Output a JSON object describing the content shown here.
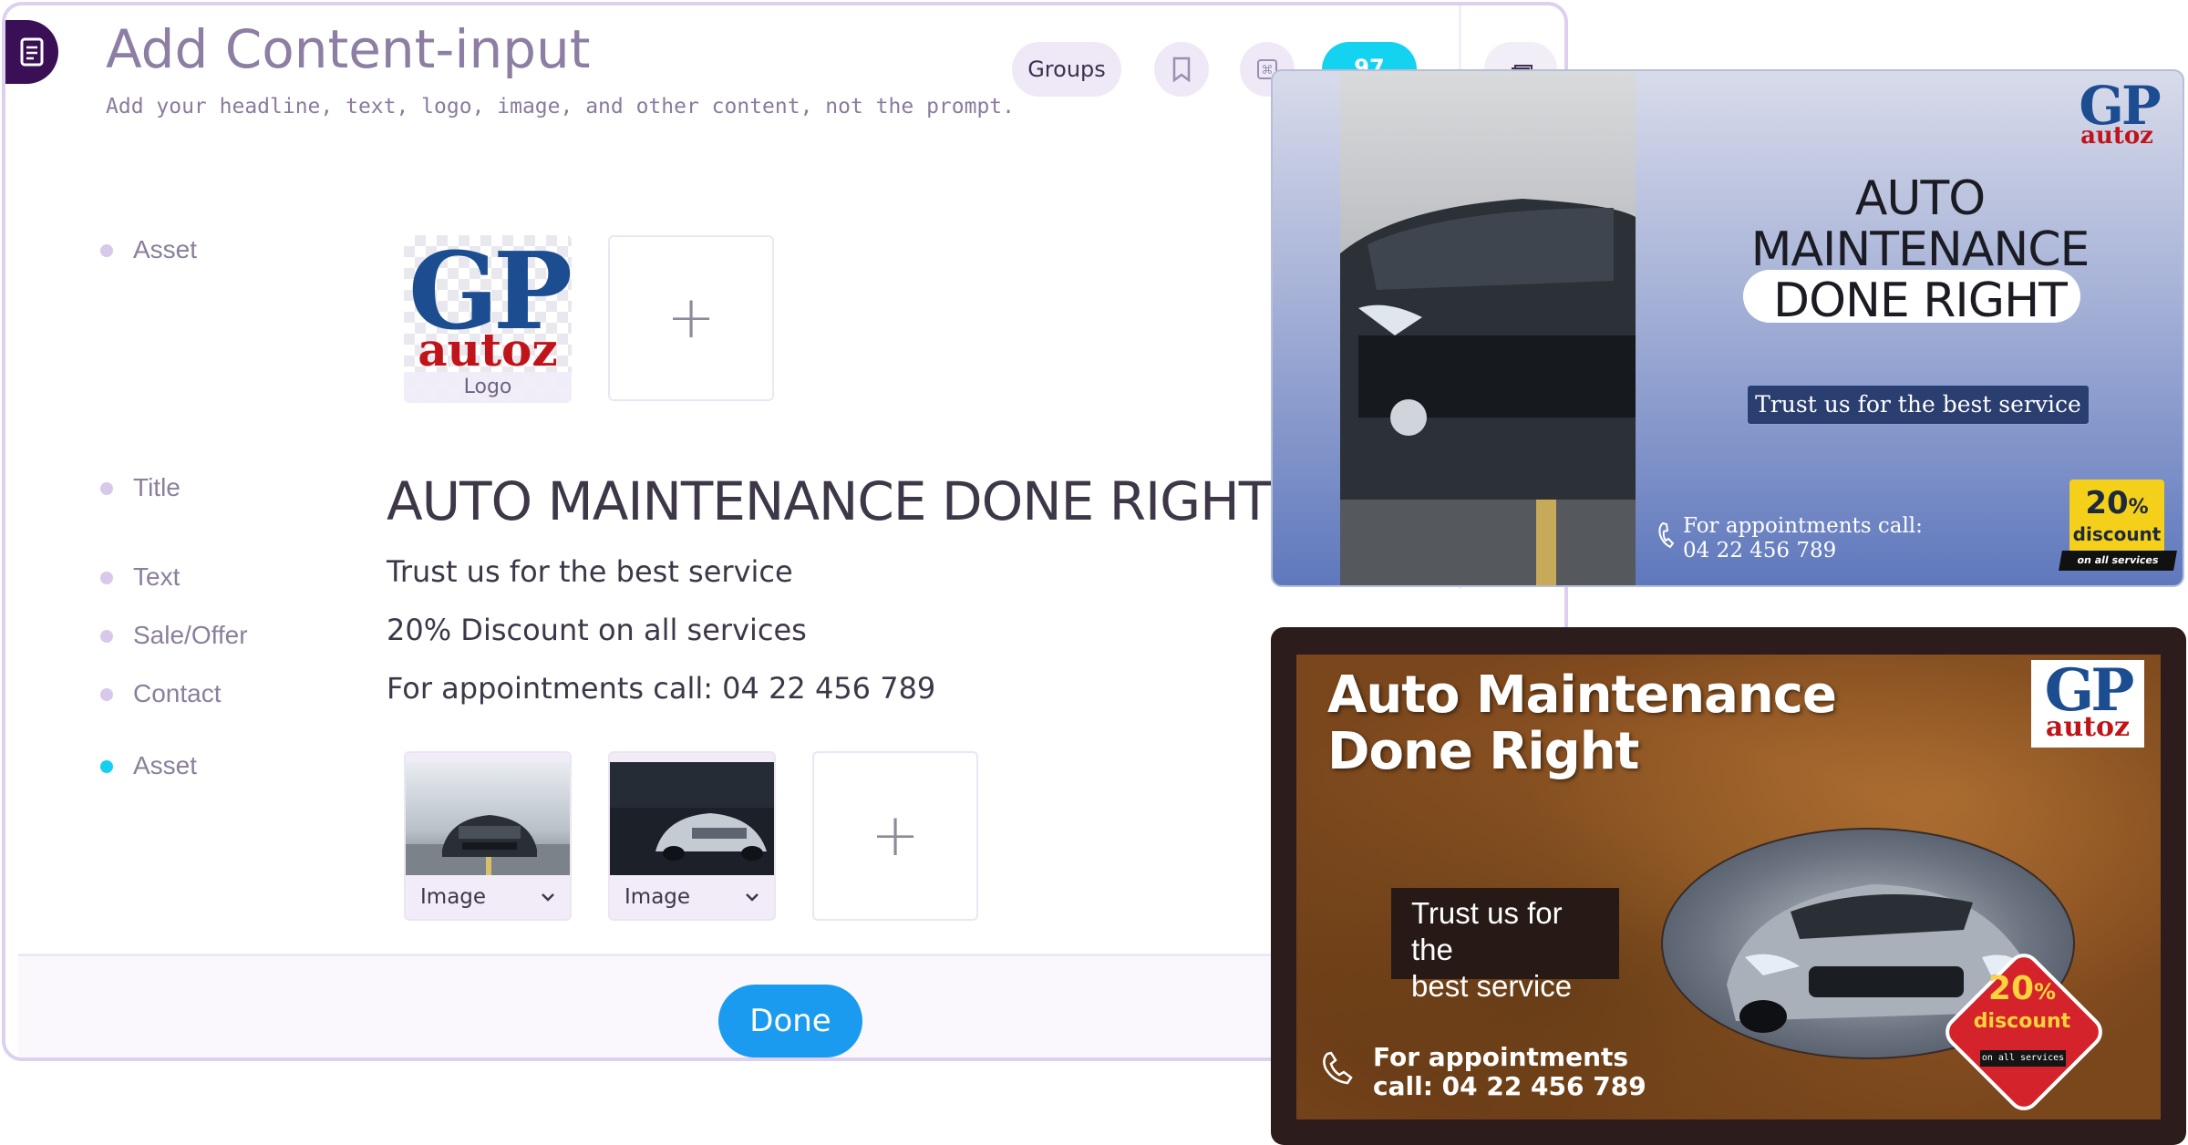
{
  "editor": {
    "title": "Add Content-input",
    "subtitle": "Add your headline, text, logo, image, and other content, not the prompt.",
    "toolbar": {
      "groups_label": "Groups",
      "counter": "97"
    },
    "fields": [
      {
        "label": "Asset"
      },
      {
        "label": "Title",
        "value": "AUTO MAINTENANCE DONE RIGHT"
      },
      {
        "label": "Text",
        "value": "Trust us for the best service"
      },
      {
        "label": "Sale/Offer",
        "value": "20% Discount on all services"
      },
      {
        "label": "Contact",
        "value": "For appointments call: 04 22 456 789"
      },
      {
        "label": "Asset"
      }
    ],
    "logo_asset": {
      "mark_gp": "GP",
      "mark_autoz": "autoz",
      "caption": "Logo"
    },
    "add_glyph": "+",
    "image_assets": [
      {
        "type_label": "Image"
      },
      {
        "type_label": "Image"
      }
    ],
    "done_label": "Done"
  },
  "ad_preview_1": {
    "logo_gp": "GP",
    "logo_autoz": "autoz",
    "title_line1": "AUTO",
    "title_line2": "MAINTENANCE",
    "title_line3": "DONE RIGHT",
    "text": "Trust us for the best service",
    "contact_line1": "For appointments call:",
    "contact_line2": "04 22 456 789",
    "discount_pct": "20",
    "discount_pct_sign": "%",
    "discount_word": "discount",
    "discount_note": "on all services"
  },
  "ad_preview_2": {
    "title_line1": "Auto Maintenance",
    "title_line2": "Done Right",
    "logo_gp": "GP",
    "logo_autoz": "autoz",
    "text_line1": "Trust us for the",
    "text_line2": "best service",
    "discount_pct": "20",
    "discount_pct_sign": "%",
    "discount_word": "discount",
    "discount_note": "on all services",
    "contact_line1": "For appointments",
    "contact_line2": "call: 04 22 456 789"
  },
  "colors": {
    "accent_purple": "#3a0f55",
    "counter_cyan": "#13d3f0",
    "done_blue": "#1a9bf0",
    "logo_blue": "#1c4d91",
    "logo_red": "#c0141a",
    "discount_yellow": "#f4d01b",
    "discount_red": "#d4232a"
  },
  "icons": [
    "document-icon",
    "bookmark-icon",
    "command-icon",
    "stack-icon",
    "chevron-down-icon",
    "phone-icon"
  ]
}
